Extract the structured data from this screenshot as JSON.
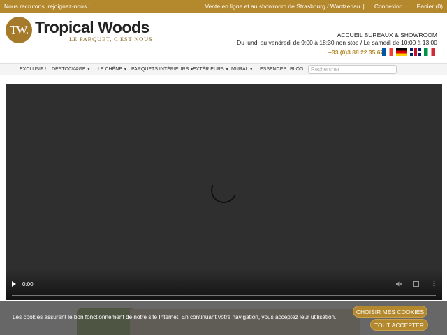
{
  "topbar": {
    "recruit": "Nous recrutons, rejoignez-nous !",
    "sale_info": "Vente en ligne et au showroom de Strasbourg / Wantzenau",
    "sep": "|",
    "login": "Connexion",
    "cart": "Panier (0)",
    "bg_color": "#b4882c"
  },
  "header": {
    "logo_mark": "TW.",
    "brand": "Tropical Woods",
    "tagline": "LE PARQUET, C'EST NOUS",
    "office": "ACCUEIL BUREAUX & SHOWROOM",
    "hours": "Du lundi au vendredi de 9:00 à 18:30 non stop / Le samedi de 10:00 à 13:00",
    "phone": "+33 (0)3 88 22 35 67",
    "flags": [
      "flag-fr-icon",
      "flag-de-icon",
      "flag-uk-icon",
      "flag-it-icon"
    ]
  },
  "nav": {
    "items": [
      {
        "label": "EXCLUSIF !"
      },
      {
        "label": "DESTOCKAGE"
      },
      {
        "label": "LE CHÊNE"
      },
      {
        "label": "PARQUETS INTÉRIEURS"
      },
      {
        "label": "EXTÉRIEURS"
      },
      {
        "label": "MURAL"
      },
      {
        "label": "ESSENCES"
      },
      {
        "label": "BLOG"
      }
    ],
    "search_placeholder": "Rechercher",
    "caret": "▼"
  },
  "video": {
    "time": "0:00",
    "controls": [
      "play-icon",
      "mute-icon",
      "fullscreen-icon",
      "more-options-icon"
    ]
  },
  "cookie": {
    "text": "Les cookies assurent le bon fonctionnement de notre site Internet. En continuant votre navigation, vous acceptez leur utilisation.",
    "choose": "CHOISIR MES COOKIES",
    "accept": "TOUT ACCEPTER",
    "btn_color": "#b4882c"
  }
}
